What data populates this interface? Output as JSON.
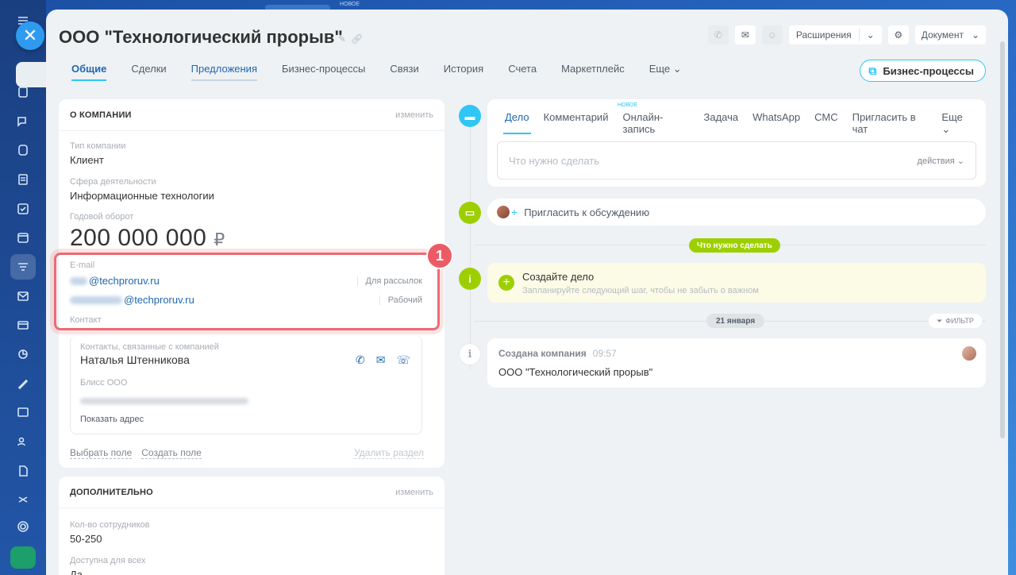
{
  "window": {
    "title": "ООО \"Технологический прорыв\"",
    "top_peek_new": "НОВОЕ"
  },
  "header": {
    "extensions_label": "Расширения",
    "document_label": "Документ"
  },
  "tabs": [
    {
      "label": "Общие",
      "active": true
    },
    {
      "label": "Сделки"
    },
    {
      "label": "Предложения"
    },
    {
      "label": "Бизнес-процессы"
    },
    {
      "label": "Связи"
    },
    {
      "label": "История"
    },
    {
      "label": "Счета"
    },
    {
      "label": "Маркетплейс"
    },
    {
      "label": "Еще"
    }
  ],
  "bp_button": "Бизнес-процессы",
  "about": {
    "title": "О компании",
    "edit": "изменить",
    "company_type_label": "Тип компании",
    "company_type": "Клиент",
    "industry_label": "Сфера деятельности",
    "industry": "Информационные технологии",
    "revenue_label": "Годовой оборот",
    "revenue": "200 000 000",
    "currency": "₽",
    "email_label": "E-mail",
    "emails": [
      {
        "value": "@techproruv.ru",
        "type": "Для рассылок"
      },
      {
        "value": "@techproruv.ru",
        "type": "Рабочий"
      }
    ],
    "contact_label": "Контакт",
    "contacts_label": "Контакты, связанные с компанией",
    "contact_name": "Наталья Штенникова",
    "contact_company": "Блисс ООО",
    "show_address": "Показать адрес",
    "select_field": "Выбрать поле",
    "create_field": "Создать поле",
    "delete_section": "Удалить раздел",
    "badge": "1"
  },
  "extra": {
    "title": "Дополнительно",
    "edit": "изменить",
    "employees_label": "Кол-во сотрудников",
    "employees": "50-250",
    "available_label": "Доступна для всех",
    "available": "Да"
  },
  "composer": {
    "tabs": [
      "Дело",
      "Комментарий",
      "Онлайн-запись",
      "Задача",
      "WhatsApp",
      "СМС",
      "Пригласить в чат",
      "Еще"
    ],
    "new_tag": "Новое",
    "placeholder": "Что нужно сделать",
    "actions": "действия"
  },
  "timeline": {
    "invite": "Пригласить к обсуждению",
    "todo_pill": "Что нужно сделать",
    "create_title": "Создайте дело",
    "create_sub": "Запланируйте следующий шаг, чтобы не забыть о важном",
    "date_pill": "21 января",
    "filter": "ФИЛЬТР",
    "event_title": "Создана компания",
    "event_time": "09:57",
    "event_text": "ООО \"Технологический прорыв\""
  },
  "colors": {
    "accent": "#2fc6f6",
    "link": "#2067b0",
    "green": "#9dcf00",
    "highlight": "#ec6b71"
  }
}
